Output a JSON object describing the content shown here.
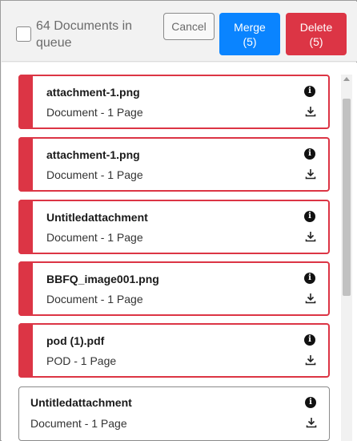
{
  "header": {
    "queue_text": "64 Documents in queue",
    "cancel_label": "Cancel",
    "merge_label": "Merge",
    "merge_count": "(5)",
    "delete_label": "Delete",
    "delete_count": "(5)"
  },
  "colors": {
    "accent_blue": "#0a84ff",
    "danger_red": "#dc3545"
  },
  "documents": [
    {
      "name": "attachment-1.png",
      "meta": "Document - 1 Page",
      "selected": true
    },
    {
      "name": "attachment-1.png",
      "meta": "Document - 1 Page",
      "selected": true
    },
    {
      "name": "Untitledattachment",
      "meta": "Document - 1 Page",
      "selected": true
    },
    {
      "name": "BBFQ_image001.png",
      "meta": "Document - 1 Page",
      "selected": true
    },
    {
      "name": "pod (1).pdf",
      "meta": "POD - 1 Page",
      "selected": true
    },
    {
      "name": "Untitledattachment",
      "meta": "Document - 1 Page",
      "selected": false
    }
  ],
  "icons": {
    "info": "info-icon",
    "download": "download-icon",
    "checkbox": "select-all-checkbox"
  }
}
